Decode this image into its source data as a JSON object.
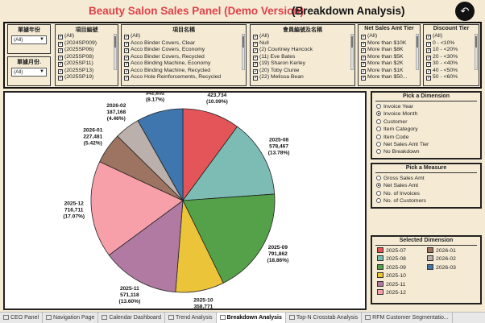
{
  "header": {
    "title": "Beauty Salon Sales Panel (Demo Version)",
    "subtitle": "(Breakdown Analysis)",
    "back_icon": "back-arrow-icon"
  },
  "filters": {
    "year": {
      "label": "單據年份",
      "value": "(All)"
    },
    "month": {
      "label": "單據月份.",
      "value": "(All)"
    },
    "project_id": {
      "label": "項目編號",
      "items": [
        "(All)",
        "(2024SP009)",
        "(2025SP06)",
        "(2025SP08)",
        "(2025SP11)",
        "(2025SP13)",
        "(2025SP19)"
      ]
    },
    "project_name": {
      "label": "項目名稱",
      "items": [
        "(All)",
        "Acco Binder Covers, Clear",
        "Acco Binder Covers, Economy",
        "Acco Binder Covers, Recycled",
        "Acco Binding Machine, Economy",
        "Acco Binding Machine, Recycled",
        "Acco Hole Reinforcements, Recycled"
      ]
    },
    "member": {
      "label": "會員編號及名稱",
      "items": [
        "(All)",
        "Null",
        "(2) Courtney Hancock",
        "(11) Eve Bates",
        "(19) Sharon Kerley",
        "(20) Toby Clunie",
        "(22) Melissa Bean"
      ]
    },
    "net_sales_tier": {
      "label": "Net Sales Amt Tier",
      "items": [
        "(All)",
        "More than $10K",
        "More than $8K",
        "More than $5K",
        "More than $2K",
        "More than $1K",
        "More than $50..."
      ]
    },
    "discount_tier": {
      "label": "Discount Tier",
      "items": [
        "(All)",
        "0 - <10%",
        "10 - <20%",
        "20 - <30%",
        "30 - <40%",
        "40 - <50%",
        "50 - <60%"
      ]
    }
  },
  "dimension": {
    "label": "Pick a Dimension",
    "options": [
      "Invoice Year",
      "Invoice Month",
      "Customer",
      "Item Category",
      "Item Code",
      "Net Sales Amt Tier",
      "No Breakdown"
    ],
    "selected": "Invoice Month"
  },
  "measure": {
    "label": "Pick a Measure",
    "options": [
      "Gross Sales Amt",
      "Net Sales Amt",
      "No. of Invoices",
      "No. of Customers"
    ],
    "selected": "Net Sales Amt"
  },
  "legend": {
    "label": "Selected Dimension",
    "items": [
      {
        "name": "2025-07",
        "color": "#e35558"
      },
      {
        "name": "2025-08",
        "color": "#7dbcb5"
      },
      {
        "name": "2025-09",
        "color": "#55a14a"
      },
      {
        "name": "2025-10",
        "color": "#ecc43a"
      },
      {
        "name": "2025-11",
        "color": "#b07aa2"
      },
      {
        "name": "2025-12",
        "color": "#f8a0aa"
      },
      {
        "name": "2026-01",
        "color": "#9c7461"
      },
      {
        "name": "2026-02",
        "color": "#bbb0ac"
      },
      {
        "name": "2026-03",
        "color": "#3f76ad"
      }
    ]
  },
  "chart_data": {
    "type": "pie",
    "categories": [
      "2025-07",
      "2025-08",
      "2025-09",
      "2025-10",
      "2025-11",
      "2025-12",
      "2026-01",
      "2026-02",
      "2026-03"
    ],
    "values": [
      423734,
      578467,
      791862,
      358771,
      571118,
      716711,
      227481,
      187168,
      342852
    ],
    "value_labels": [
      "423,734",
      "578,467",
      "791,862",
      "358,771",
      "571,118",
      "716,711",
      "227,481",
      "187,168",
      "342,852"
    ],
    "percent_labels": [
      "(10.09%)",
      "(13.78%)",
      "(18.86%)",
      "(8.55%)",
      "(13.60%)",
      "(17.07%)",
      "(5.42%)",
      "(4.46%)",
      "(8.17%)"
    ],
    "colors": [
      "#e35558",
      "#7dbcb5",
      "#55a14a",
      "#ecc43a",
      "#b07aa2",
      "#f8a0aa",
      "#9c7461",
      "#bbb0ac",
      "#3f76ad"
    ]
  },
  "tabs": [
    "CEO Panel",
    "Navigation Page",
    "Calendar Dashboard",
    "Trend Analysis",
    "Breakdown Analysis",
    "Top-N Crosstab Analysis",
    "RFM Customer Segmentatio..."
  ],
  "active_tab": "Breakdown Analysis"
}
